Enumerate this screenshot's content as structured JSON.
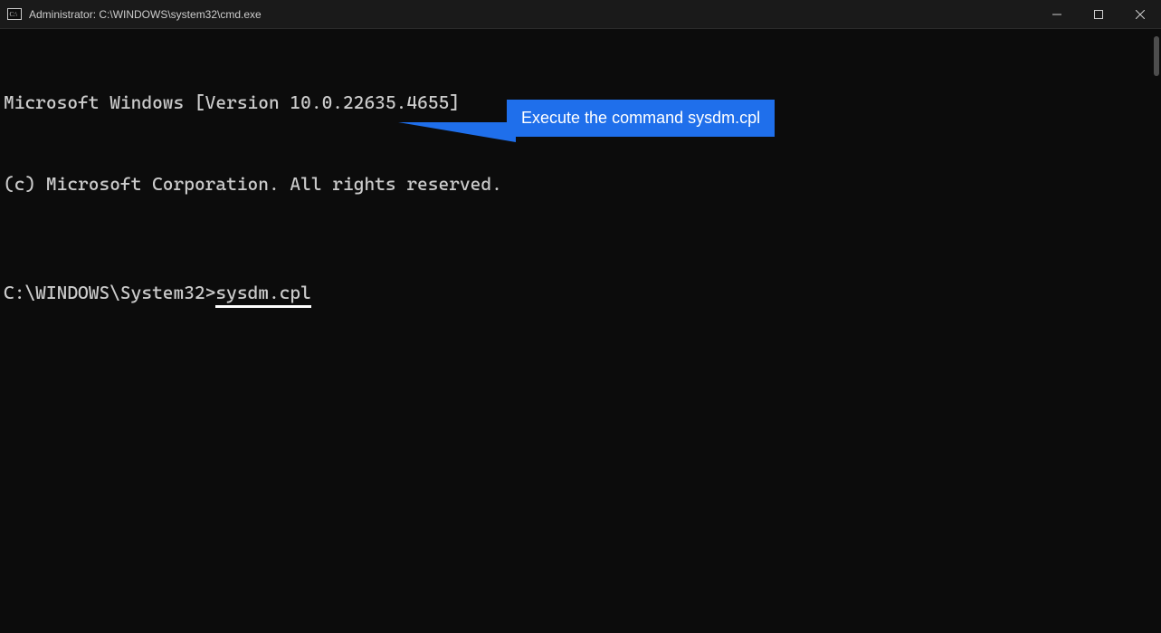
{
  "titlebar": {
    "title": "Administrator: C:\\WINDOWS\\system32\\cmd.exe"
  },
  "terminal": {
    "line1": "Microsoft Windows [Version 10.0.22635.4655]",
    "line2": "(c) Microsoft Corporation. All rights reserved.",
    "prompt": "C:\\WINDOWS\\System32>",
    "command": "sysdm.cpl"
  },
  "callout": {
    "text": "Execute the command sysdm.cpl"
  }
}
